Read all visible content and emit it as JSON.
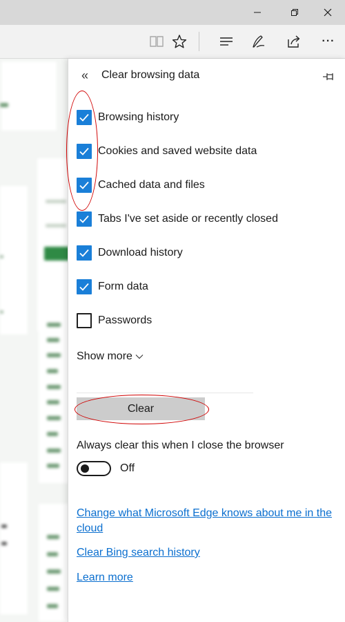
{
  "window": {
    "controls": [
      "minimize",
      "restore",
      "close"
    ]
  },
  "toolbar": {
    "icons": [
      "reading-view-icon",
      "favorite-star-icon",
      "hub-icon",
      "web-note-icon",
      "share-icon",
      "more-icon"
    ],
    "more_label": "···"
  },
  "panel": {
    "back_glyph": "«",
    "title": "Clear browsing data",
    "options": [
      {
        "label": "Browsing history",
        "checked": true
      },
      {
        "label": "Cookies and saved website data",
        "checked": true
      },
      {
        "label": "Cached data and files",
        "checked": true
      },
      {
        "label": "Tabs I've set aside or recently closed",
        "checked": true
      },
      {
        "label": "Download history",
        "checked": true
      },
      {
        "label": "Form data",
        "checked": true
      },
      {
        "label": "Passwords",
        "checked": false
      }
    ],
    "show_more_label": "Show more",
    "clear_button_label": "Clear",
    "always_clear_label": "Always clear this when I close the browser",
    "always_clear_state": "Off",
    "links": {
      "cloud": "Change what Microsoft Edge knows about me in the cloud",
      "bing": "Clear Bing search history",
      "learn": "Learn more"
    }
  },
  "colors": {
    "accent": "#1a7fd8",
    "link": "#0b6fcf",
    "annotation": "#d00000",
    "clear_button": "#cccccc"
  }
}
